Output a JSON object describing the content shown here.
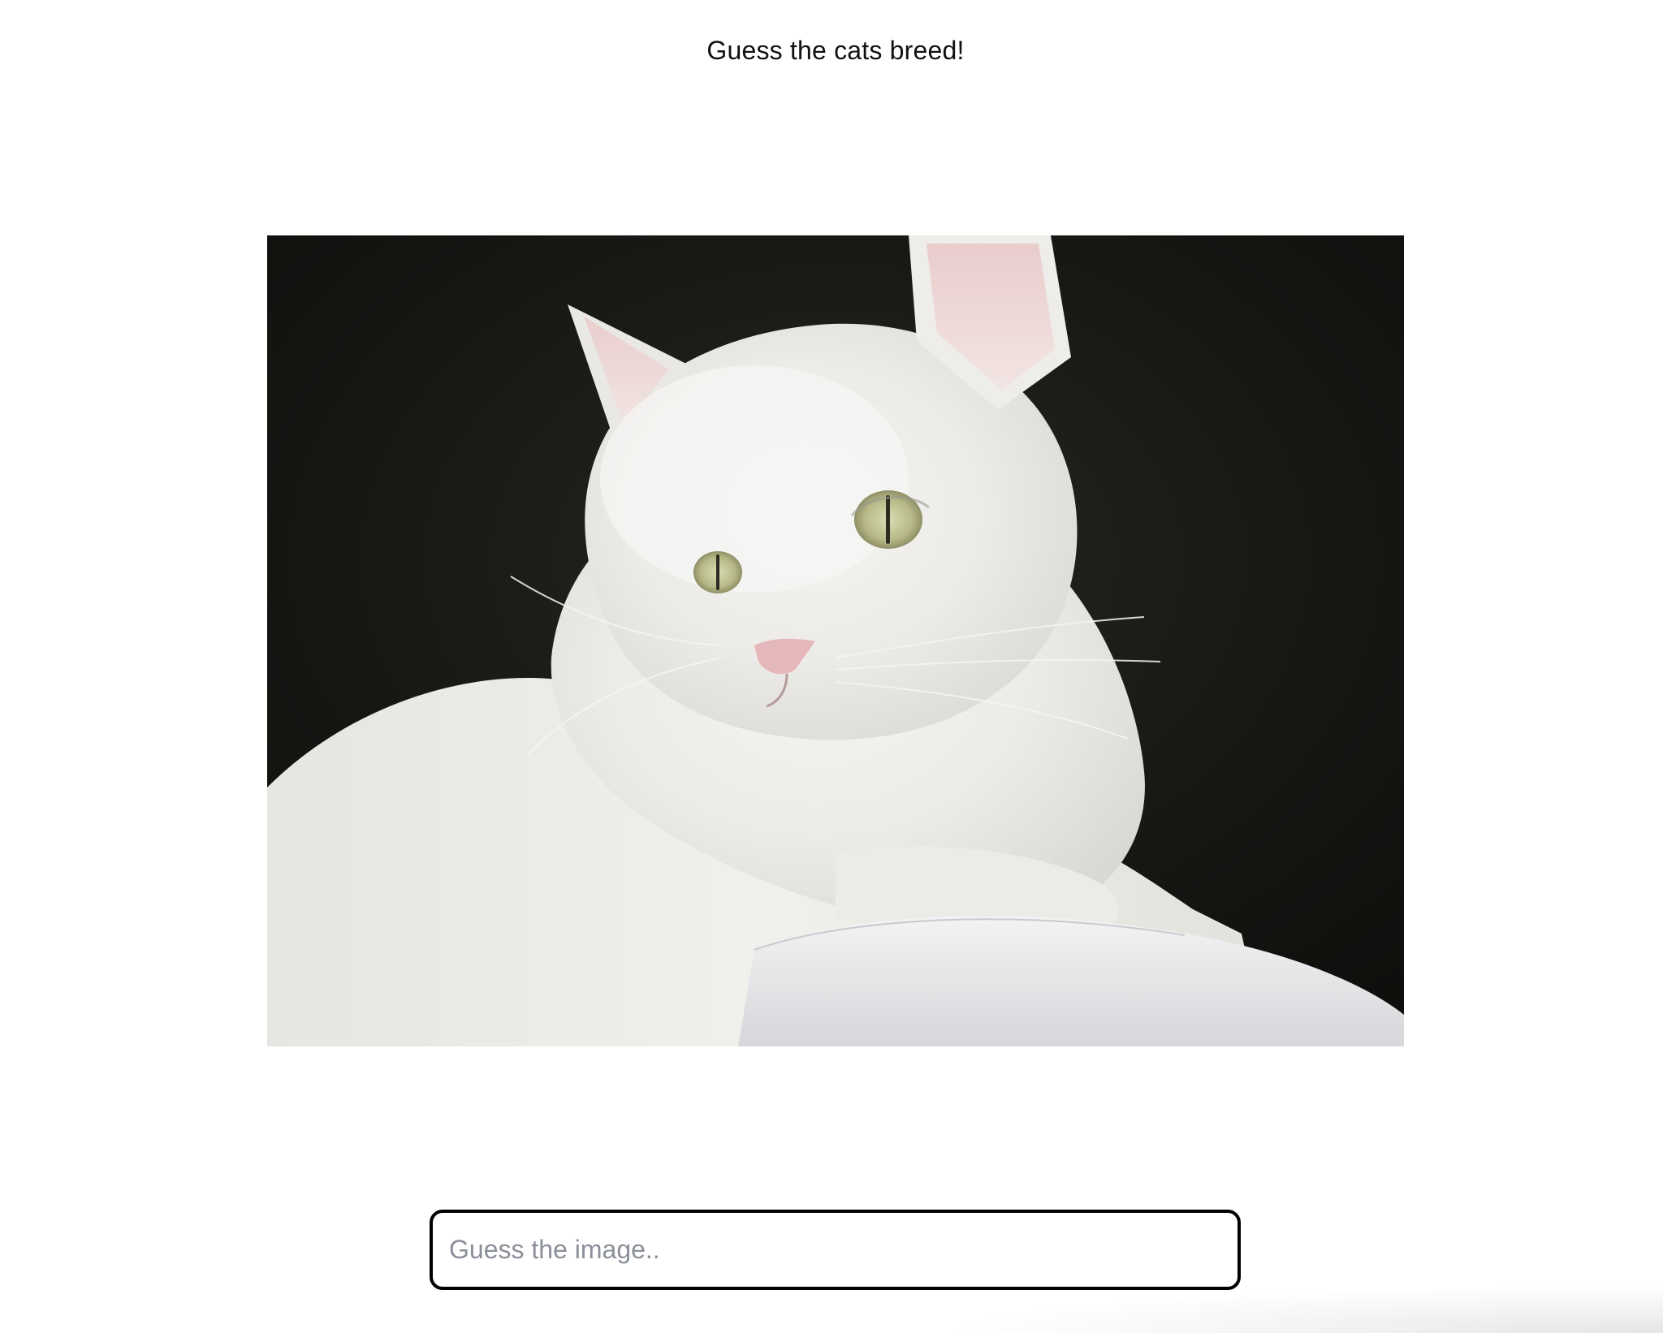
{
  "header": {
    "title": "Guess the cats breed!"
  },
  "image": {
    "subject": "white-longhair-cat-photo"
  },
  "guess": {
    "placeholder": "Guess the image..",
    "value": ""
  }
}
